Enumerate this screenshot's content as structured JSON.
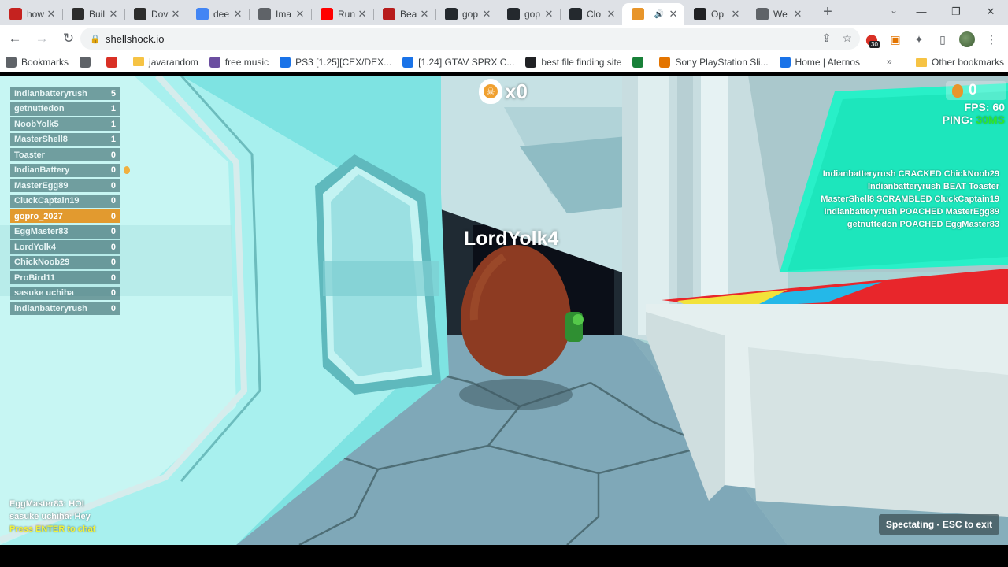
{
  "browser": {
    "tabs": [
      {
        "title": "how",
        "icon": "shellshock-favicon-icon",
        "color": "#c5221f",
        "active": false
      },
      {
        "title": "Buil",
        "icon": "nvidia-favicon-icon",
        "color": "#2d2d2d",
        "active": false
      },
      {
        "title": "Dov",
        "icon": "nvidia-favicon-icon",
        "color": "#2d2d2d",
        "active": false
      },
      {
        "title": "dee",
        "icon": "google-favicon-icon",
        "color": "#4285f4",
        "active": false
      },
      {
        "title": "Ima",
        "icon": "chart-favicon-icon",
        "color": "#5f6368",
        "active": false
      },
      {
        "title": "Run",
        "icon": "youtube-favicon-icon",
        "color": "#ff0000",
        "active": false
      },
      {
        "title": "Bea",
        "icon": "medium-favicon-icon",
        "color": "#b71c1c",
        "active": false
      },
      {
        "title": "gop",
        "icon": "github-favicon-icon",
        "color": "#24292e",
        "active": false
      },
      {
        "title": "gop",
        "icon": "github-favicon-icon",
        "color": "#24292e",
        "active": false
      },
      {
        "title": "Clo",
        "icon": "github-favicon-icon",
        "color": "#24292e",
        "active": false
      },
      {
        "title": "",
        "icon": "shellshock-favicon-icon",
        "color": "#e8952a",
        "active": true,
        "audio": "speaker-icon"
      },
      {
        "title": "Op",
        "icon": "openai-favicon-icon",
        "color": "#202124",
        "active": false
      },
      {
        "title": "We",
        "icon": "globe-favicon-icon",
        "color": "#5f6368",
        "active": false
      }
    ],
    "new_tab": "+",
    "url": "shellshock.io",
    "bookmarks": [
      {
        "label": "Bookmarks",
        "icon": "bookmarks-apps-icon",
        "color": "#5f6368"
      },
      {
        "label": "",
        "icon": "globe-icon",
        "color": "#5f6368"
      },
      {
        "label": "",
        "icon": "heart-icon",
        "color": "#d93025"
      },
      {
        "label": "javarandom",
        "icon": "folder-icon",
        "color": "#f6c344"
      },
      {
        "label": "free music",
        "icon": "music-icon",
        "color": "#6b4ea0"
      },
      {
        "label": "PS3 [1.25][CEX/DEX...",
        "icon": "ps3-icon",
        "color": "#1a73e8"
      },
      {
        "label": "[1.24] GTAV SPRX C...",
        "icon": "gtav-icon",
        "color": "#1a73e8"
      },
      {
        "label": "best file finding site",
        "icon": "file-site-icon",
        "color": "#202124"
      },
      {
        "label": "",
        "icon": "spreadsheet-icon",
        "color": "#188038"
      },
      {
        "label": "Sony PlayStation Sli...",
        "icon": "sony-icon",
        "color": "#e37400"
      },
      {
        "label": "Home | Aternos",
        "icon": "aternos-icon",
        "color": "#1a73e8"
      }
    ],
    "other_bookmarks": "Other bookmarks",
    "extension_badge": "30"
  },
  "game": {
    "kill_count": "x0",
    "egg_balance": "0",
    "fps_label": "FPS: 60",
    "ping_label": "PING: ",
    "ping_value": "30MS",
    "leaderboard": [
      {
        "name": "Indianbatteryrush",
        "score": "5"
      },
      {
        "name": "getnuttedon",
        "score": "1"
      },
      {
        "name": "NoobYolk5",
        "score": "1"
      },
      {
        "name": "MasterShell8",
        "score": "1"
      },
      {
        "name": "Toaster",
        "score": "0"
      },
      {
        "name": "IndianBattery",
        "score": "0"
      },
      {
        "name": "MasterEgg89",
        "score": "0"
      },
      {
        "name": "CluckCaptain19",
        "score": "0"
      },
      {
        "name": "gopro_2027",
        "score": "0",
        "me": true
      },
      {
        "name": "EggMaster83",
        "score": "0"
      },
      {
        "name": "LordYolk4",
        "score": "0"
      },
      {
        "name": "ChickNoob29",
        "score": "0"
      },
      {
        "name": "ProBird11",
        "score": "0"
      },
      {
        "name": "sasuke uchiha",
        "score": "0"
      },
      {
        "name": "indianbatteryrush",
        "score": "0"
      }
    ],
    "kill_feed": [
      "Indianbatteryrush CRACKED ChickNoob29",
      "Indianbatteryrush BEAT Toaster",
      "MasterShell8 SCRAMBLED CluckCaptain19",
      "Indianbatteryrush POACHED MasterEgg89",
      "getnuttedon POACHED EggMaster83"
    ],
    "spectated_player": "LordYolk4",
    "chat": [
      "EggMaster83: HOI",
      "sasuke uchiha: Hey"
    ],
    "chat_hint": "Press ENTER to chat",
    "spectating_label": "Spectating - ESC to exit"
  }
}
